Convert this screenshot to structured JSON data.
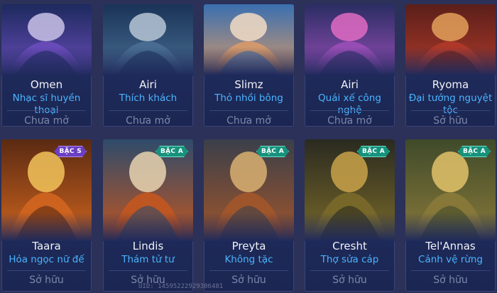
{
  "skins_row1": [
    {
      "hero": "Omen",
      "skin": "Nhạc sĩ huyền thoại",
      "status": "Chưa mở",
      "palette": [
        "#1d2a5e",
        "#6b4dbb",
        "#c9c2e8"
      ]
    },
    {
      "hero": "Airi",
      "skin": "Thích khách",
      "status": "Chưa mở",
      "palette": [
        "#1a3358",
        "#4a6f93",
        "#b7c6d6"
      ]
    },
    {
      "hero": "Slimz",
      "skin": "Thỏ nhồi bông",
      "status": "Chưa mở",
      "palette": [
        "#3a6fb0",
        "#d89a6a",
        "#f2dcc4"
      ]
    },
    {
      "hero": "Airi",
      "skin": "Quái xế công nghệ",
      "status": "Chưa mở",
      "palette": [
        "#2a2d63",
        "#9a4fb8",
        "#e06bc3"
      ]
    },
    {
      "hero": "Ryoma",
      "skin": "Đại tướng nguyệt tộc",
      "status": "Sở hữu",
      "palette": [
        "#5a1f1a",
        "#b03a2a",
        "#e3a05a"
      ]
    }
  ],
  "skins_row2": [
    {
      "hero": "Taara",
      "skin": "Hỏa ngọc nữ đế",
      "status": "Sở hữu",
      "badge": "BẬC S",
      "badge_tier": "s",
      "palette": [
        "#5a2a12",
        "#d0651f",
        "#f2c35a"
      ]
    },
    {
      "hero": "Lindis",
      "skin": "Thám tử tư",
      "status": "Sở hữu",
      "badge": "BẬC A",
      "badge_tier": "a",
      "palette": [
        "#2e4b6b",
        "#c3561f",
        "#e7d3b0"
      ]
    },
    {
      "hero": "Preyta",
      "skin": "Không tặc",
      "status": "Sở hữu",
      "badge": "BẬC A",
      "badge_tier": "a",
      "palette": [
        "#3a3f4a",
        "#a3562a",
        "#d9b071"
      ]
    },
    {
      "hero": "Cresht",
      "skin": "Thợ sửa cáp",
      "status": "Sở hữu",
      "badge": "BẬC A",
      "badge_tier": "a",
      "palette": [
        "#2a2a20",
        "#7a6a2a",
        "#c9a24a"
      ]
    },
    {
      "hero": "Tel'Annas",
      "skin": "Cảnh vệ rừng",
      "status": "Sở hữu",
      "badge": "BẬC A",
      "badge_tier": "a",
      "palette": [
        "#3f4a2a",
        "#8a7a3a",
        "#e2c26a"
      ]
    }
  ],
  "uid_text": "UID: 14595222929306481"
}
